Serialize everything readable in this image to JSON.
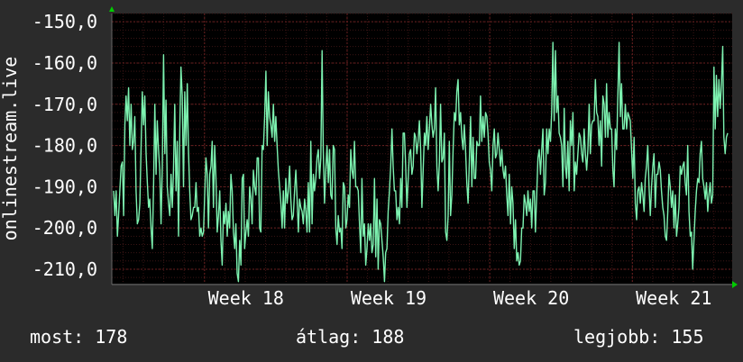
{
  "chart_data": {
    "type": "line",
    "ylabel": "onlinestream.live",
    "ylim": [
      -213.5,
      -148
    ],
    "yticks": [
      -150,
      -160,
      -170,
      -180,
      -190,
      -200,
      -210
    ],
    "ytick_labels": [
      "-150,0",
      "-160,0",
      "-170,0",
      "-180,0",
      "-190,0",
      "-200,0",
      "-210,0"
    ],
    "x_range_weeks": [
      17.35,
      21.7
    ],
    "x_ticks": [
      {
        "label": "Week 18",
        "week": 18
      },
      {
        "label": "Week 19",
        "week": 19
      },
      {
        "label": "Week 20",
        "week": 20
      },
      {
        "label": "Week 21",
        "week": 21
      }
    ],
    "grid": true,
    "colors": {
      "background": "#2b2b2b",
      "plot_bg": "#000000",
      "grid": "#5a1a1a",
      "line": "#7df2b0",
      "axis_arrow": "#00cc00",
      "text": "#ffffff"
    },
    "series": [
      {
        "values": [
          -191,
          -197,
          -191,
          -202,
          -197,
          -191,
          -185,
          -184,
          -197,
          -175,
          -168,
          -174,
          -166,
          -180,
          -170,
          -181,
          -179,
          -173,
          -191,
          -199,
          -198,
          -194,
          -180,
          -167,
          -175,
          -168,
          -182,
          -189,
          -195,
          -193,
          -200,
          -205,
          -190,
          -170,
          -187,
          -174,
          -181,
          -186,
          -199,
          -185,
          -158,
          -182,
          -169,
          -190,
          -194,
          -197,
          -187,
          -195,
          -186,
          -170,
          -191,
          -179,
          -202,
          -176,
          -161,
          -168,
          -190,
          -167,
          -180,
          -165,
          -181,
          -191,
          -198,
          -197,
          -195,
          -195,
          -189,
          -196,
          -195,
          -202,
          -200,
          -202,
          -201,
          -192,
          -183,
          -187,
          -200,
          -187,
          -185,
          -179,
          -195,
          -180,
          -188,
          -201,
          -197,
          -191,
          -203,
          -209,
          -196,
          -199,
          -194,
          -202,
          -196,
          -200,
          -187,
          -191,
          -201,
          -205,
          -199,
          -211,
          -213,
          -203,
          -209,
          -188,
          -187,
          -205,
          -201,
          -198,
          -202,
          -190,
          -193,
          -199,
          -186,
          -190,
          -192,
          -183,
          -183,
          -200,
          -201,
          -180,
          -181,
          -173,
          -162,
          -180,
          -167,
          -173,
          -175,
          -178,
          -170,
          -179,
          -173,
          -180,
          -186,
          -190,
          -194,
          -200,
          -191,
          -200,
          -188,
          -194,
          -191,
          -185,
          -193,
          -198,
          -197,
          -191,
          -186,
          -193,
          -201,
          -193,
          -195,
          -196,
          -199,
          -193,
          -196,
          -201,
          -189,
          -201,
          -179,
          -199,
          -187,
          -191,
          -188,
          -183,
          -181,
          -188,
          -183,
          -157,
          -181,
          -194,
          -186,
          -180,
          -189,
          -181,
          -192,
          -193,
          -180,
          -181,
          -200,
          -204,
          -197,
          -201,
          -200,
          -205,
          -189,
          -190,
          -200,
          -198,
          -192,
          -195,
          -181,
          -186,
          -188,
          -179,
          -190,
          -190,
          -191,
          -199,
          -206,
          -188,
          -202,
          -199,
          -209,
          -205,
          -199,
          -203,
          -199,
          -206,
          -204,
          -188,
          -207,
          -193,
          -210,
          -198,
          -199,
          -203,
          -207,
          -213,
          -206,
          -205,
          -196,
          -191,
          -185,
          -176,
          -185,
          -191,
          -191,
          -198,
          -195,
          -199,
          -188,
          -195,
          -177,
          -177,
          -185,
          -195,
          -188,
          -182,
          -181,
          -187,
          -185,
          -177,
          -178,
          -182,
          -179,
          -174,
          -181,
          -195,
          -186,
          -177,
          -180,
          -173,
          -181,
          -176,
          -170,
          -175,
          -178,
          -176,
          -166,
          -185,
          -191,
          -184,
          -170,
          -184,
          -183,
          -177,
          -201,
          -203,
          -197,
          -179,
          -197,
          -192,
          -181,
          -172,
          -174,
          -167,
          -164,
          -175,
          -172,
          -178,
          -181,
          -175,
          -181,
          -189,
          -194,
          -184,
          -173,
          -190,
          -178,
          -188,
          -188,
          -179,
          -180,
          -180,
          -168,
          -179,
          -173,
          -178,
          -172,
          -173,
          -177,
          -184,
          -186,
          -191,
          -180,
          -176,
          -183,
          -182,
          -177,
          -181,
          -185,
          -181,
          -186,
          -188,
          -185,
          -192,
          -197,
          -187,
          -199,
          -190,
          -194,
          -205,
          -198,
          -208,
          -206,
          -209,
          -208,
          -200,
          -200,
          -192,
          -194,
          -197,
          -191,
          -196,
          -193,
          -200,
          -191,
          -191,
          -201,
          -192,
          -183,
          -181,
          -187,
          -181,
          -176,
          -192,
          -189,
          -176,
          -182,
          -176,
          -179,
          -172,
          -155,
          -174,
          -157,
          -172,
          -168,
          -177,
          -178,
          -180,
          -190,
          -171,
          -185,
          -188,
          -179,
          -191,
          -174,
          -180,
          -172,
          -191,
          -184,
          -187,
          -182,
          -177,
          -178,
          -182,
          -184,
          -176,
          -182,
          -186,
          -181,
          -170,
          -182,
          -175,
          -174,
          -174,
          -164,
          -172,
          -173,
          -180,
          -174,
          -185,
          -168,
          -170,
          -178,
          -165,
          -178,
          -172,
          -176,
          -176,
          -186,
          -190,
          -176,
          -181,
          -168,
          -155,
          -173,
          -165,
          -176,
          -176,
          -170,
          -176,
          -172,
          -173,
          -174,
          -181,
          -188,
          -178,
          -194,
          -198,
          -191,
          -190,
          -194,
          -189,
          -192,
          -196,
          -188,
          -185,
          -180,
          -190,
          -197,
          -190,
          -185,
          -182,
          -195,
          -187,
          -187,
          -184,
          -186,
          -191,
          -195,
          -197,
          -202,
          -203,
          -196,
          -187,
          -190,
          -195,
          -191,
          -200,
          -192,
          -202,
          -199,
          -195,
          -185,
          -187,
          -185,
          -184,
          -189,
          -192,
          -180,
          -196,
          -202,
          -201,
          -210,
          -203,
          -196,
          -191,
          -188,
          -189,
          -182,
          -179,
          -188,
          -190,
          -193,
          -189,
          -196,
          -192,
          -189,
          -194,
          -192,
          -161,
          -176,
          -163,
          -173,
          -164,
          -171,
          -165,
          -156,
          -178,
          -182,
          -178,
          -177
        ]
      }
    ],
    "summary": {
      "current": "most: 178",
      "average": "átlag: 188",
      "best": "legjobb: 155"
    }
  }
}
